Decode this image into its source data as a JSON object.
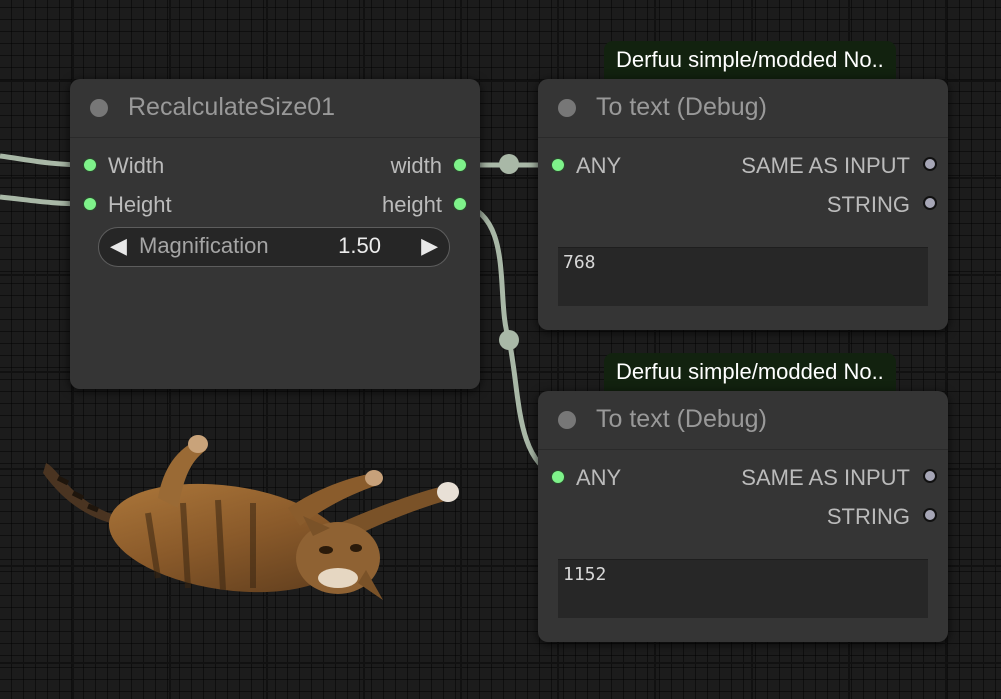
{
  "colors": {
    "canvas": "#1c1c1c",
    "node_body": "#353535",
    "link": "#a9b8a7",
    "connected_port": "#7ef28a",
    "unconnected_port": "#a6a6b6",
    "badge_bg": "#12220f"
  },
  "recalc_node": {
    "title": "RecalculateSize01",
    "inputs": [
      "Width",
      "Height"
    ],
    "outputs": [
      "width",
      "height"
    ],
    "widget": {
      "label": "Magnification",
      "value": "1.50",
      "left_arrow": "◀",
      "right_arrow": "▶"
    }
  },
  "debug_nodes": [
    {
      "badge": "Derfuu simple/modded No..",
      "title": "To text (Debug)",
      "input": "ANY",
      "outputs": [
        "SAME AS INPUT",
        "STRING"
      ],
      "text_value": "768"
    },
    {
      "badge": "Derfuu simple/modded No..",
      "title": "To text (Debug)",
      "input": "ANY",
      "outputs": [
        "SAME AS INPUT",
        "STRING"
      ],
      "text_value": "1152"
    }
  ],
  "decoration": {
    "image": "flying-cat-image"
  }
}
